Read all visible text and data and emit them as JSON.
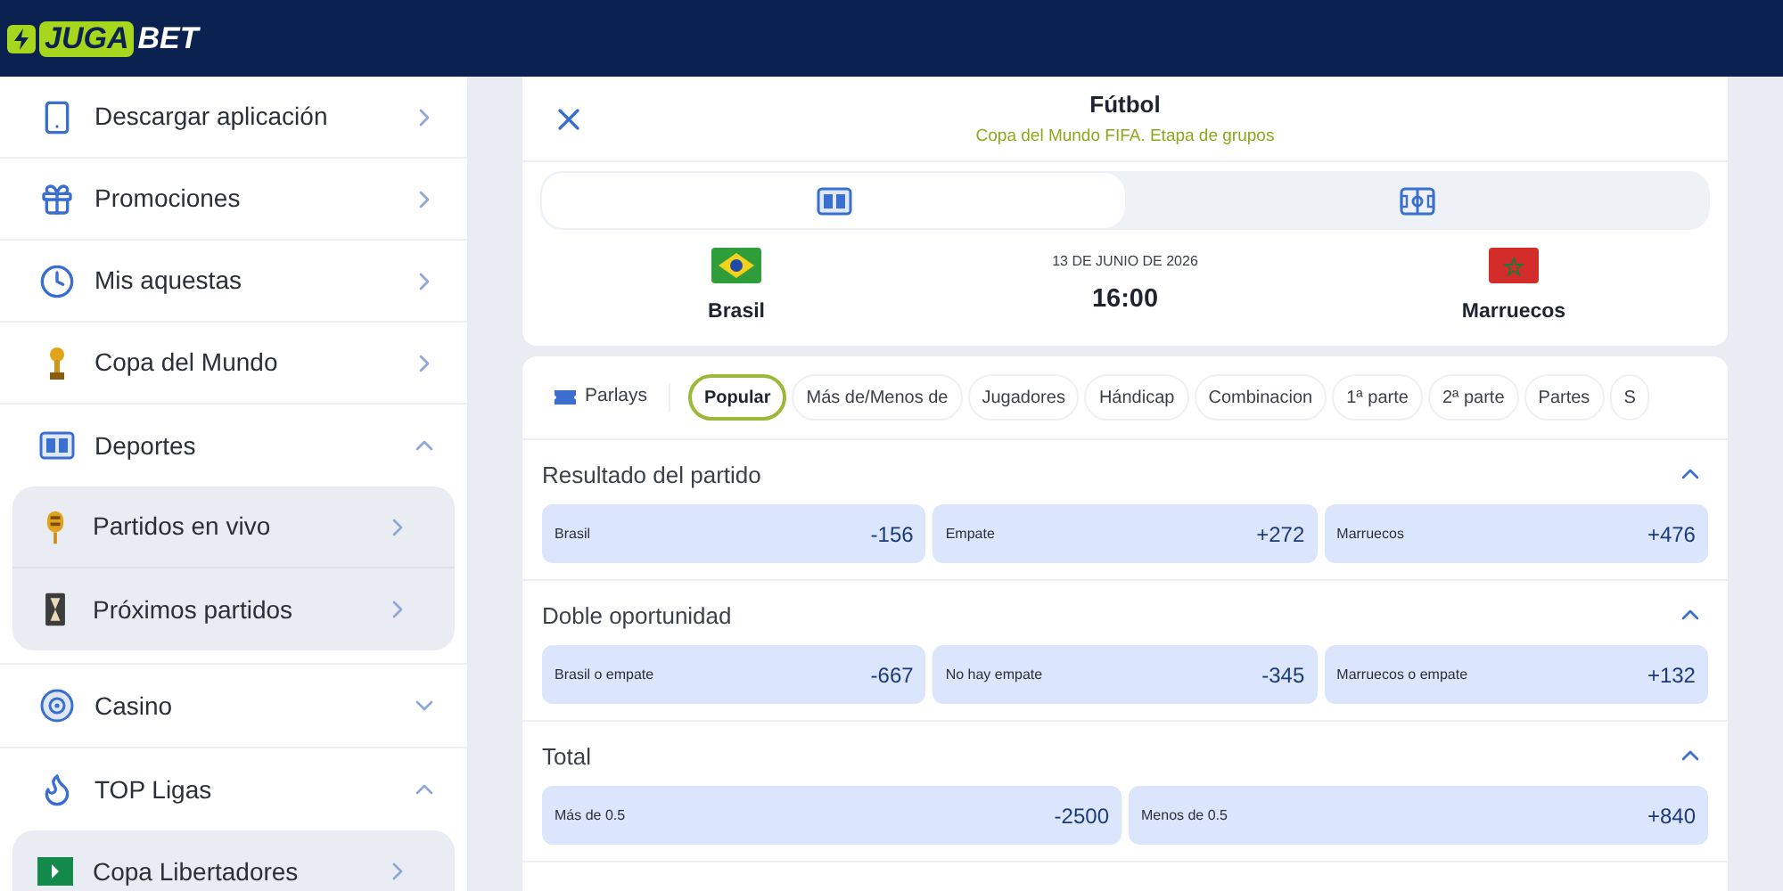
{
  "brand": {
    "part1": "JUGA",
    "part2": "BET"
  },
  "sidebar": {
    "items": [
      {
        "kind": "link",
        "label": "Descargar aplicación"
      },
      {
        "kind": "link",
        "label": "Promociones"
      },
      {
        "kind": "link",
        "label": "Mis aquestas"
      },
      {
        "kind": "link",
        "label": "Copa del Mundo"
      },
      {
        "kind": "group",
        "label": "Deportes",
        "expanded": true,
        "children": [
          {
            "label": "Partidos en vivo"
          },
          {
            "label": "Próximos partidos"
          }
        ]
      },
      {
        "kind": "group",
        "label": "Casino",
        "expanded": false
      },
      {
        "kind": "group",
        "label": "TOP Ligas",
        "expanded": true,
        "children": [
          {
            "label": "Copa Libertadores"
          }
        ]
      }
    ]
  },
  "match": {
    "title": "Fútbol",
    "subtitle": "Copa del Mundo FIFA. Etapa de grupos",
    "views": [
      {
        "selected": true
      },
      {
        "selected": false
      }
    ],
    "home": {
      "name": "Brasil"
    },
    "date": "13 DE JUNIO DE 2026",
    "time": "16:00",
    "away": {
      "name": "Marruecos"
    }
  },
  "markets": {
    "parlays": "Parlays",
    "filters": [
      {
        "label": "Popular",
        "selected": true
      },
      {
        "label": "Más de/Menos de",
        "selected": false
      },
      {
        "label": "Jugadores",
        "selected": false
      },
      {
        "label": "Hándicap",
        "selected": false
      },
      {
        "label": "Combinacion",
        "selected": false
      },
      {
        "label": "1ª parte",
        "selected": false
      },
      {
        "label": "2ª parte",
        "selected": false
      },
      {
        "label": "Partes",
        "selected": false
      },
      {
        "label": "S",
        "selected": false
      }
    ],
    "sections": [
      {
        "title": "Resultado del partido",
        "expanded": true,
        "outcomes": [
          {
            "label": "Brasil",
            "odds": "-156"
          },
          {
            "label": "Empate",
            "odds": "+272"
          },
          {
            "label": "Marruecos",
            "odds": "+476"
          }
        ]
      },
      {
        "title": "Doble oportunidad",
        "expanded": true,
        "outcomes": [
          {
            "label": "Brasil o empate",
            "odds": "-667"
          },
          {
            "label": "No hay empate",
            "odds": "-345"
          },
          {
            "label": "Marruecos o empate",
            "odds": "+132"
          }
        ]
      },
      {
        "title": "Total",
        "expanded": true,
        "outcomes": [
          {
            "label": "Más de 0.5",
            "odds": "-2500"
          },
          {
            "label": "Menos de 0.5",
            "odds": "+840"
          }
        ]
      }
    ]
  }
}
